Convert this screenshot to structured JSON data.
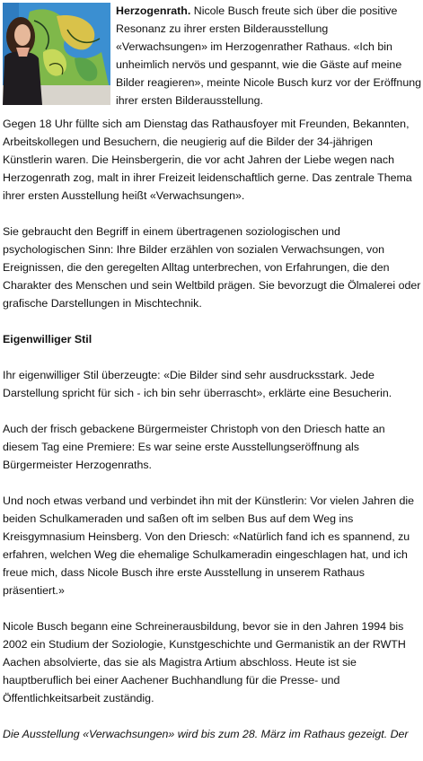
{
  "article": {
    "photo_alt": "Nicole Busch vor ihrem Bild",
    "dateline": "Herzogenrath.",
    "lead": "Nicole Busch freute sich über die positive Resonanz zu ihrer ersten Bilderausstellung «Verwachsungen» im Herzogenrather Rathaus. «Ich bin unheimlich nervös und gespannt, wie die Gäste auf meine Bilder reagieren», meinte Nicole Busch kurz vor der Eröffnung ihrer ersten Bilderausstellung.",
    "paragraphs": [
      "Gegen 18 Uhr füllte sich am Dienstag das Rathausfoyer mit Freunden, Bekannten, Arbeitskollegen und Besuchern, die neugierig auf die Bilder der 34-jährigen Künstlerin waren. Die Heinsbergerin, die vor acht Jahren der Liebe wegen nach Herzogenrath zog, malt in ihrer Freizeit leidenschaftlich gerne. Das zentrale Thema ihrer ersten Ausstellung heißt «Verwachsungen».",
      "Sie gebraucht den Begriff in einem übertragenen soziologischen und psychologischen Sinn: Ihre Bilder erzählen von sozialen Verwachsungen, von Ereignissen, die den geregelten Alltag unterbrechen, von Erfahrungen, die den Charakter des Menschen und sein Weltbild prägen. Sie bevorzugt die Ölmalerei oder grafische Darstellungen in Mischtechnik."
    ],
    "subheading": "Eigenwilliger Stil",
    "paragraphs2": [
      "Ihr eigenwilliger Stil überzeugte: «Die Bilder sind sehr ausdrucksstark. Jede Darstellung spricht für sich - ich bin sehr überrascht», erklärte eine Besucherin.",
      "Auch der frisch gebackene Bürgermeister Christoph von den Driesch hatte an diesem Tag eine Premiere: Es war seine erste Ausstellungseröffnung als Bürgermeister Herzogenraths.",
      "Und noch etwas verband und verbindet ihn mit der Künstlerin: Vor vielen Jahren die beiden Schulkameraden und saßen oft im selben Bus auf dem Weg ins Kreisgymnasium Heinsberg. Von den Driesch: «Natürlich fand ich es spannend, zu erfahren, welchen Weg die ehemalige Schulkameradin eingeschlagen hat, und ich freue mich, dass Nicole Busch ihre erste Ausstellung in unserem Rathaus präsentiert.»",
      "Nicole Busch begann eine Schreinerausbildung, bevor sie in den Jahren 1994 bis 2002 ein Studium der Soziologie, Kunstgeschichte und Germanistik an der RWTH Aachen absolvierte, das sie als Magistra Artium abschloss. Heute ist sie hauptberuflich bei einer Aachener Buchhandlung für die Presse- und Öffentlichkeitsarbeit zuständig."
    ],
    "closing": "Die Ausstellung «Verwachsungen» wird bis zum 28. März im Rathaus gezeigt. Der"
  }
}
